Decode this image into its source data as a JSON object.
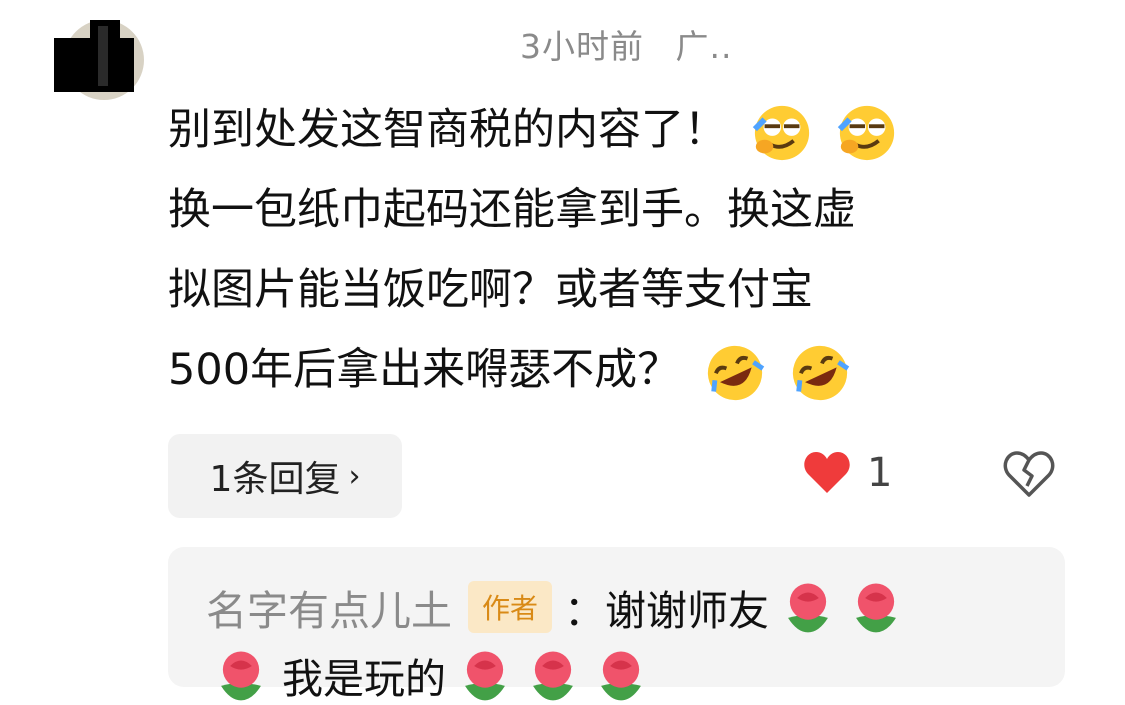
{
  "meta": {
    "time_text": "3小时前",
    "location_text": "广.."
  },
  "comment": {
    "lines": [
      "别到处发这智商税的内容了！",
      "换一包纸巾起码还能拿到手。换这虚",
      "拟图片能当饭吃啊？或者等支付宝",
      "500年后拿出来嘚瑟不成？"
    ],
    "emojis": {
      "line1": "smirk-emoji",
      "line4": "rofl-emoji"
    }
  },
  "actions": {
    "reply_label": "1条回复",
    "like_count": "1"
  },
  "reply": {
    "author": "名字有点儿土",
    "badge": "作者",
    "text": "：谢谢师友",
    "line2_text": "我是玩的"
  },
  "colors": {
    "like": "#ef3b3b",
    "badge_bg": "#fbe8c6",
    "badge_fg": "#d98a16",
    "meta": "#8a8a8a"
  }
}
